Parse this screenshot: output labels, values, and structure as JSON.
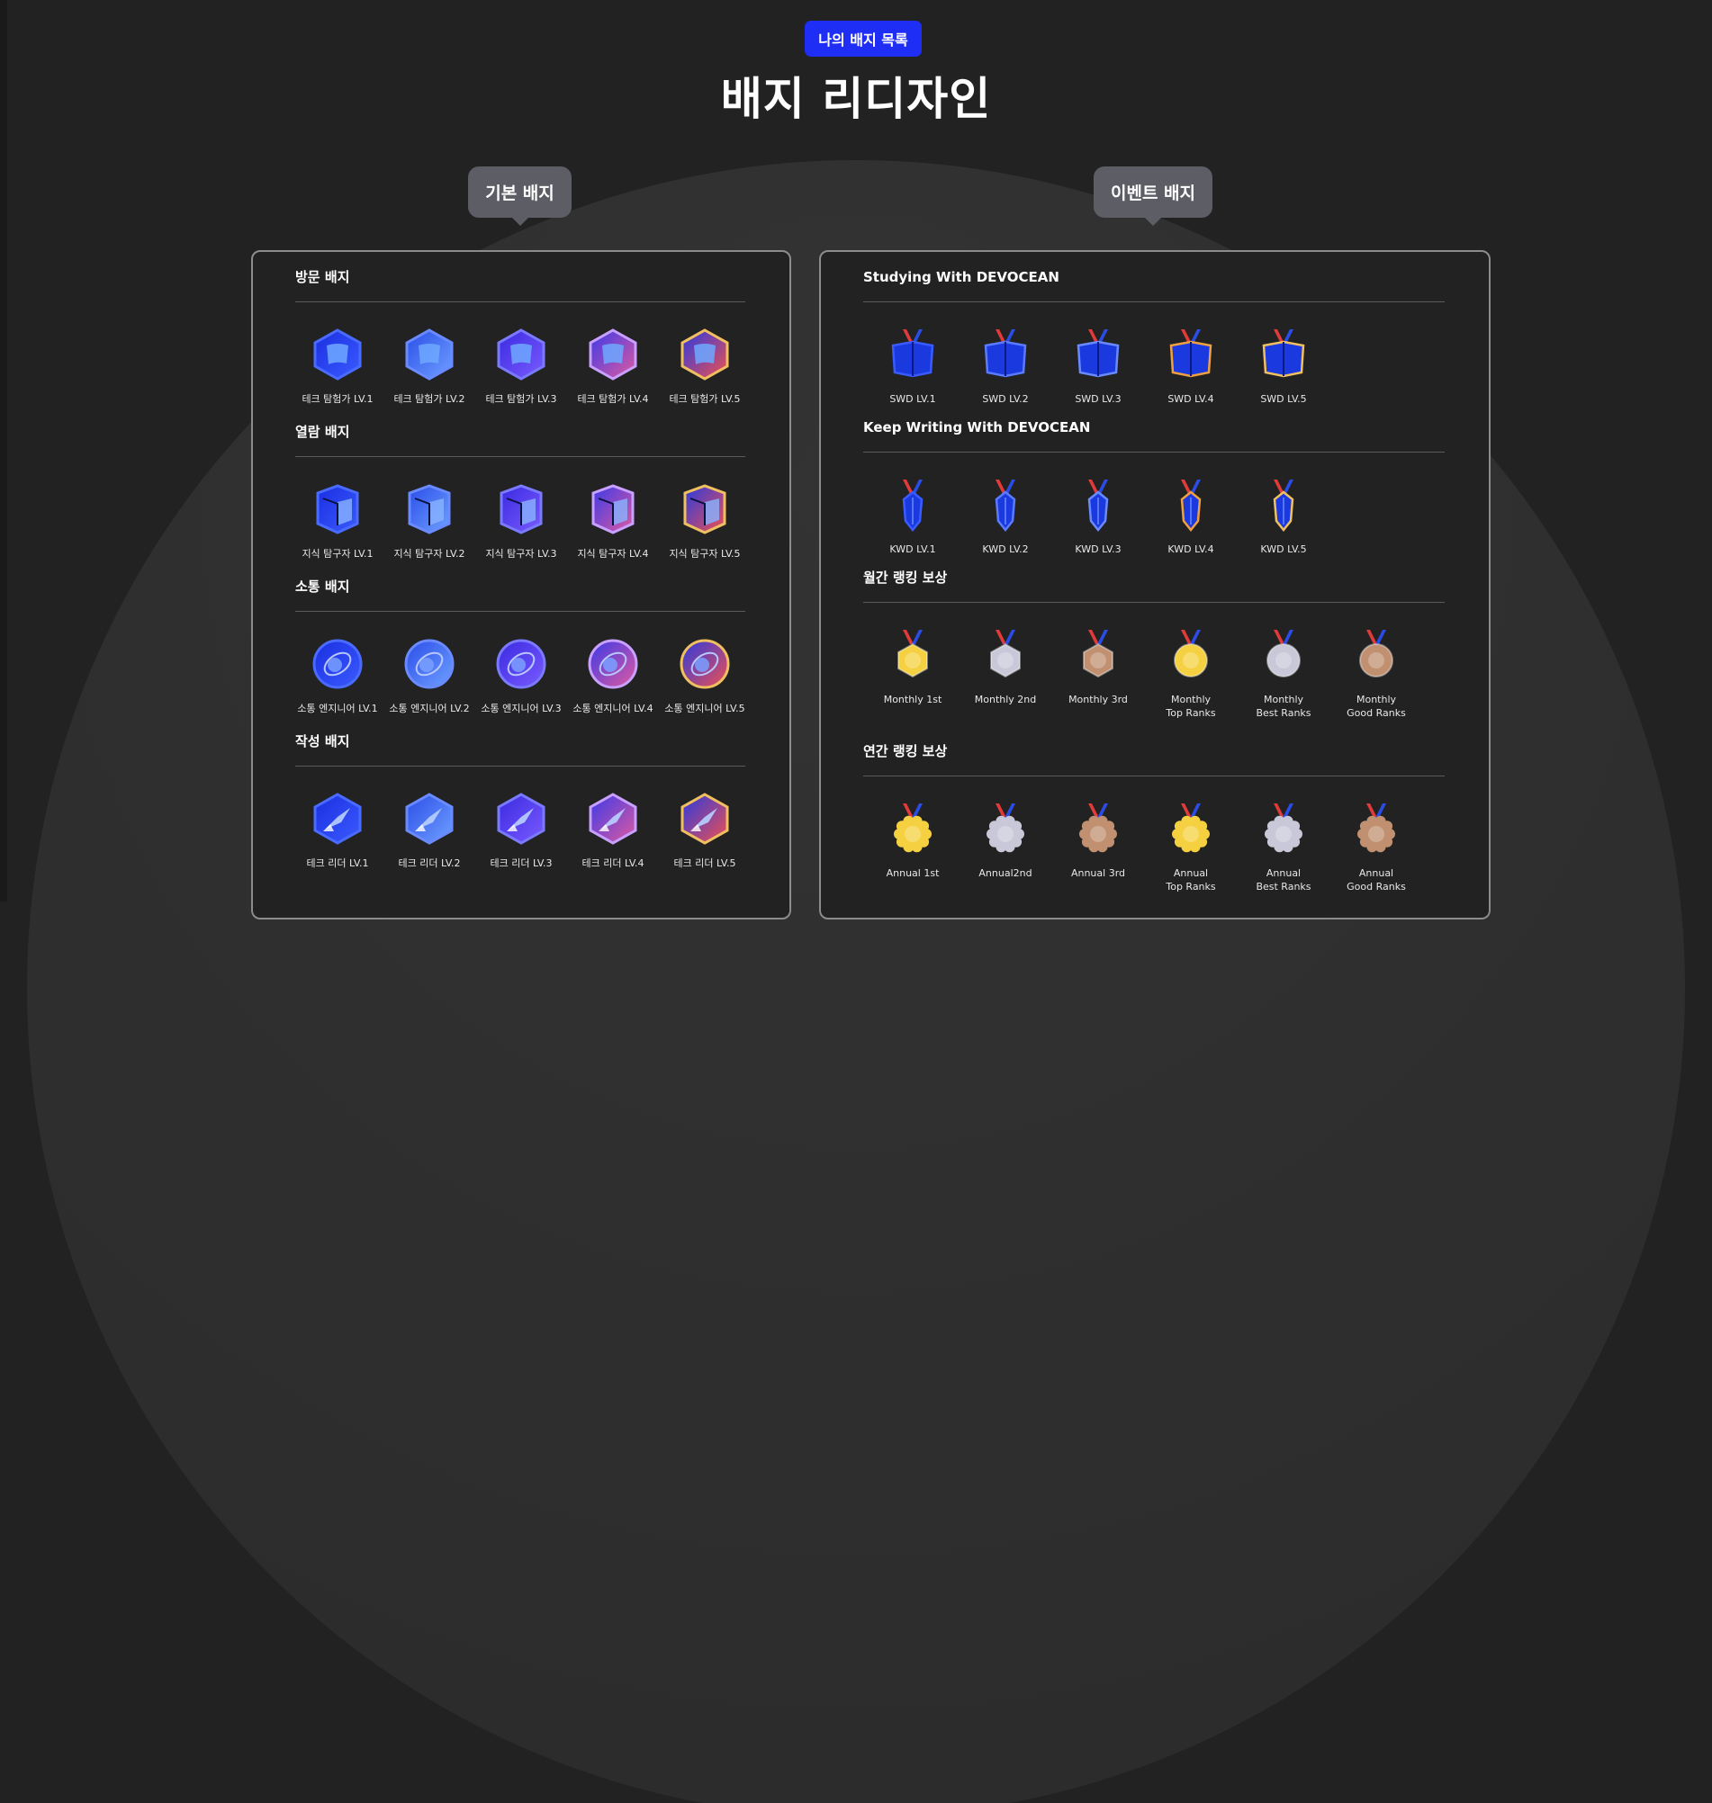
{
  "header": {
    "badge_label": "나의 배지 목록",
    "title": "배지 리디자인"
  },
  "tabs": {
    "basic_label": "기본 배지",
    "event_label": "이벤트 배지"
  },
  "basic_sections": [
    {
      "title": "방문 배지",
      "shape": "flag",
      "items": [
        "테크 탐험가 LV.1",
        "테크 탐험가 LV.2",
        "테크 탐험가 LV.3",
        "테크 탐험가 LV.4",
        "테크 탐험가 LV.5"
      ]
    },
    {
      "title": "열람 배지",
      "shape": "book",
      "items": [
        "지식 탐구자 LV.1",
        "지식 탐구자 LV.2",
        "지식 탐구자 LV.3",
        "지식 탐구자 LV.4",
        "지식 탐구자 LV.5"
      ]
    },
    {
      "title": "소통 배지",
      "shape": "orbit",
      "items": [
        "소통 엔지니어 LV.1",
        "소통 엔지니어 LV.2",
        "소통 엔지니어 LV.3",
        "소통 엔지니어 LV.4",
        "소통 엔지니어 LV.5"
      ]
    },
    {
      "title": "작성 배지",
      "shape": "pen",
      "items": [
        "테크 리더 LV.1",
        "테크 리더 LV.2",
        "테크 리더 LV.3",
        "테크 리더 LV.4",
        "테크 리더 LV.5"
      ]
    }
  ],
  "event_sections": [
    {
      "title": "Studying With DEVOCEAN",
      "shape": "book-ribbon",
      "items": [
        "SWD LV.1",
        "SWD LV.2",
        "SWD LV.3",
        "SWD LV.4",
        "SWD LV.5"
      ]
    },
    {
      "title": "Keep Writing With DEVOCEAN",
      "shape": "pen-ribbon",
      "items": [
        "KWD LV.1",
        "KWD LV.2",
        "KWD LV.3",
        "KWD LV.4",
        "KWD LV.5"
      ]
    },
    {
      "title": "월간 랭킹 보상",
      "shape": "medal-hex",
      "items": [
        "Monthly 1st",
        "Monthly 2nd",
        "Monthly 3rd",
        "Monthly\nTop Ranks",
        "Monthly\nBest Ranks",
        "Monthly\nGood Ranks"
      ]
    },
    {
      "title": "연간 랭킹 보상",
      "shape": "medal-flower",
      "items": [
        "Annual 1st",
        "Annual2nd",
        "Annual 3rd",
        "Annual\nTop Ranks",
        "Annual\nBest Ranks",
        "Annual\nGood Ranks"
      ]
    }
  ],
  "colors": {
    "accent": "#1f2ef5",
    "level_gradients": [
      [
        "#1a2ee0",
        "#3b5bff"
      ],
      [
        "#2a4de8",
        "#6fa0ff"
      ],
      [
        "#3a2ae0",
        "#7a5bff"
      ],
      [
        "#3a3ae8",
        "#e05aa0"
      ],
      [
        "#2a3ae0",
        "#f05050"
      ]
    ],
    "level_rims": [
      "#4a6bff",
      "#6a8aff",
      "#7a7aff",
      "#c8a0ff",
      "#f0c060"
    ],
    "ribbon_rims": [
      "#3a5bff",
      "#5a7bff",
      "#6a8aff",
      "#f0a040",
      "#f0c060"
    ],
    "medal_fills": [
      "#f5d040",
      "#c8c8d8",
      "#c09070",
      "#f5d040",
      "#c8c8d8",
      "#c09070"
    ],
    "ribbon_red": "#e03a3a",
    "ribbon_blue": "#2a4de8"
  }
}
